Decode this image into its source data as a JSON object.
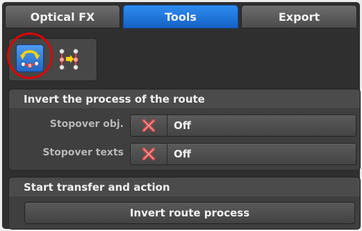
{
  "tabs": [
    {
      "label": "Optical FX",
      "active": false
    },
    {
      "label": "Tools",
      "active": true
    },
    {
      "label": "Export",
      "active": false
    }
  ],
  "toolbar": {
    "icons": [
      "invert-route-icon",
      "route-transfer-icon"
    ]
  },
  "invert_panel": {
    "title": "Invert the process of the route",
    "rows": [
      {
        "label": "Stopover obj.",
        "value": "Off"
      },
      {
        "label": "Stopover texts",
        "value": "Off"
      }
    ]
  },
  "action_panel": {
    "title": "Start transfer and action",
    "button_label": "Invert route process"
  },
  "colors": {
    "accent": "#1f73db",
    "highlight_ring": "#e00000"
  }
}
